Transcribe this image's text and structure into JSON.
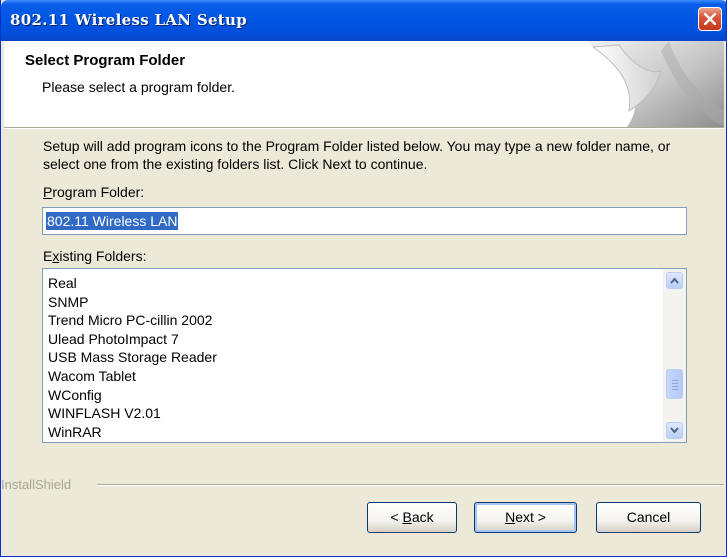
{
  "window": {
    "title": "802.11 Wireless LAN Setup"
  },
  "header": {
    "title": "Select Program Folder",
    "subtitle": "Please select a program folder."
  },
  "description": "Setup will add program icons to the Program Folder listed below.  You may type a new folder name, or select one from the existing folders list.  Click Next to continue.",
  "program_folder": {
    "label_mnemonic": "P",
    "label_rest": "rogram Folder:",
    "value": "802.11 Wireless LAN"
  },
  "existing_folders": {
    "label_first": "E",
    "label_mnemonic": "x",
    "label_rest": "isting Folders:",
    "items": [
      "Real",
      "SNMP",
      "Trend Micro PC-cillin 2002",
      "Ulead PhotoImpact 7",
      "USB Mass Storage Reader",
      "Wacom Tablet",
      "WConfig",
      "WINFLASH V2.01",
      "WinRAR"
    ]
  },
  "brand": "InstallShield",
  "buttons": {
    "back": {
      "prefix": "< ",
      "mnemonic": "B",
      "rest": "ack"
    },
    "next": {
      "mnemonic": "N",
      "rest": "ext >"
    },
    "cancel": "Cancel"
  },
  "colors": {
    "titlebar": "#0054e3",
    "selection": "#316ac5",
    "dialog_bg": "#ece9d8",
    "close_button": "#d9583a"
  },
  "icons": {
    "close": "close-icon",
    "page_curl": "page-curl-graphic",
    "scroll_up": "chevron-up-icon",
    "scroll_down": "chevron-down-icon"
  }
}
